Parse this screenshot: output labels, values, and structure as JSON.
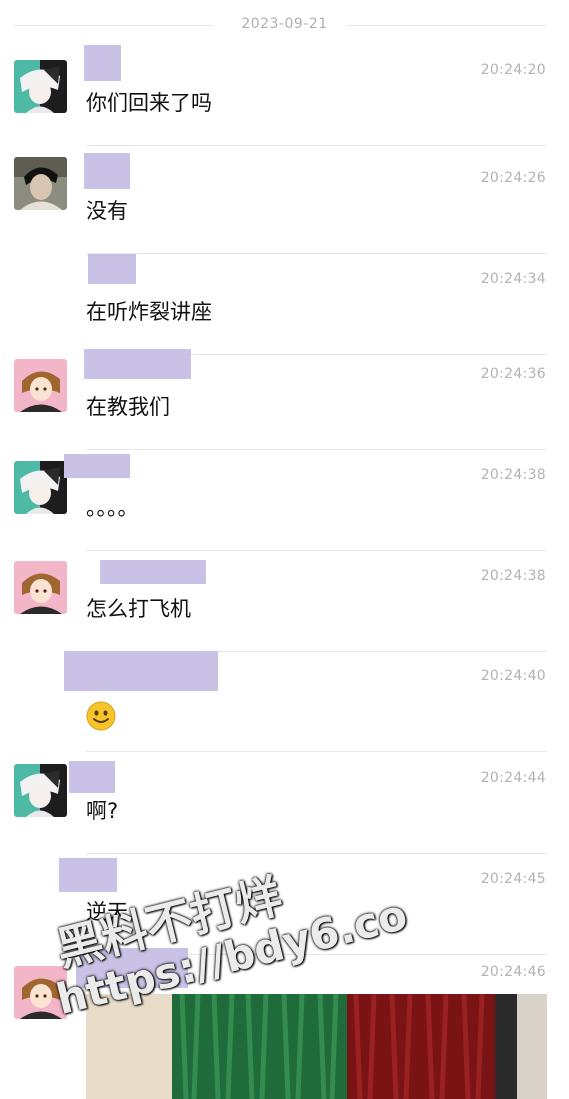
{
  "chat": {
    "date": "2023-09-21",
    "messages": [
      {
        "time": "20:24:20",
        "text": "你们回来了吗",
        "avatar": "anime-split-hair"
      },
      {
        "time": "20:24:26",
        "text": "没有",
        "avatar": "dark-hair-photo"
      },
      {
        "time": "20:24:34",
        "text": "在听炸裂讲座",
        "avatar": ""
      },
      {
        "time": "20:24:36",
        "text": "在教我们",
        "avatar": "anime-brown-hair"
      },
      {
        "time": "20:24:38",
        "text": "。。。。",
        "avatar": "anime-split-hair"
      },
      {
        "time": "20:24:38",
        "text": "怎么打飞机",
        "avatar": "anime-brown-hair"
      },
      {
        "time": "20:24:40",
        "text": "",
        "emoji": "smile-emoji",
        "avatar": ""
      },
      {
        "time": "20:24:44",
        "text": "啊?",
        "avatar": "anime-split-hair"
      },
      {
        "time": "20:24:45",
        "text": "逆天",
        "avatar": ""
      },
      {
        "time": "20:24:46",
        "text": "",
        "image": "curtain-photo",
        "avatar": "anime-brown-hair"
      }
    ]
  },
  "watermark": {
    "line1": "黑料不打烊",
    "line2": "https://bdy6.co"
  },
  "colors": {
    "redaction": "#c9c2e6",
    "timestamp": "#b3b3b3",
    "divider": "#e8e8e8"
  }
}
